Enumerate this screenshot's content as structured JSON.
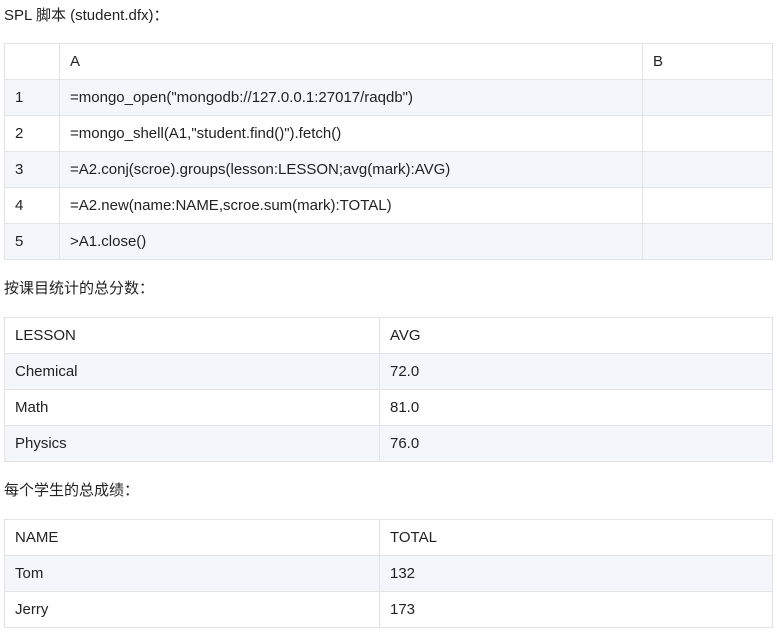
{
  "captions": {
    "script": "SPL 脚本 (student.dfx)：",
    "by_lesson": "按课目统计的总分数：",
    "by_student": "每个学生的总成绩："
  },
  "script_table": {
    "columns": [
      "",
      "A",
      "B"
    ],
    "rows": [
      {
        "num": "1",
        "a": "=mongo_open(\"mongodb://127.0.0.1:27017/raqdb\")",
        "b": ""
      },
      {
        "num": "2",
        "a": "=mongo_shell(A1,\"student.find()\").fetch()",
        "b": ""
      },
      {
        "num": "3",
        "a": "=A2.conj(scroe).groups(lesson:LESSON;avg(mark):AVG)",
        "b": ""
      },
      {
        "num": "4",
        "a": "=A2.new(name:NAME,scroe.sum(mark):TOTAL)",
        "b": ""
      },
      {
        "num": "5",
        "a": ">A1.close()",
        "b": ""
      }
    ]
  },
  "lesson_table": {
    "columns": [
      "LESSON",
      "AVG"
    ],
    "rows": [
      [
        "Chemical",
        "72.0"
      ],
      [
        "Math",
        "81.0"
      ],
      [
        "Physics",
        "76.0"
      ]
    ]
  },
  "student_table": {
    "columns": [
      "NAME",
      "TOTAL"
    ],
    "rows": [
      [
        "Tom",
        "132"
      ],
      [
        "Jerry",
        "173"
      ]
    ]
  }
}
